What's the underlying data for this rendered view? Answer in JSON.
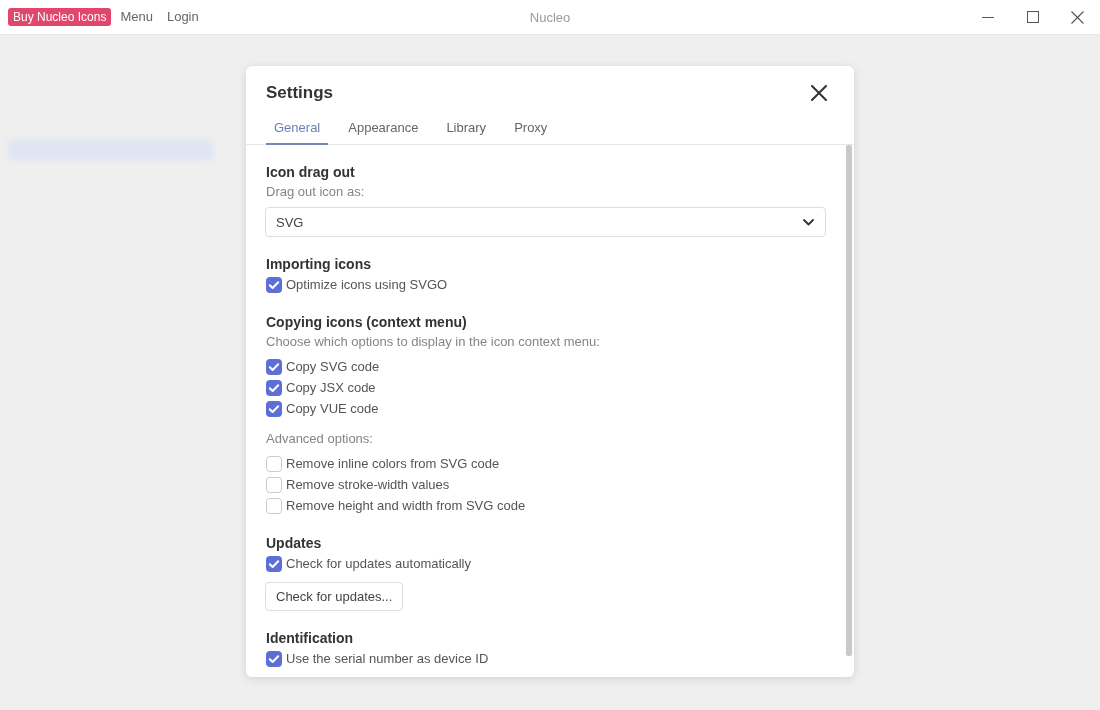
{
  "title_bar": {
    "buy_button": "Buy Nucleo Icons",
    "links": [
      "Menu",
      "Login"
    ],
    "title": "Nucleo"
  },
  "dialog": {
    "title": "Settings",
    "tabs": [
      {
        "label": "General",
        "selected": true
      },
      {
        "label": "Appearance",
        "selected": false
      },
      {
        "label": "Library",
        "selected": false
      },
      {
        "label": "Proxy",
        "selected": false
      }
    ],
    "sections": [
      {
        "heading": "Icon drag out",
        "items": [
          {
            "kind": "text",
            "text": "Drag out icon as:"
          },
          {
            "kind": "select",
            "value": "SVG"
          }
        ]
      },
      {
        "heading": "Importing icons",
        "items": [
          {
            "kind": "checkbox",
            "label": "Optimize icons using SVGO",
            "checked": true
          }
        ]
      },
      {
        "heading": "Copying icons (context menu)",
        "items": [
          {
            "kind": "text",
            "text": "Choose which options to display in the icon context menu:"
          },
          {
            "kind": "checkbox",
            "label": "Copy SVG code",
            "checked": true
          },
          {
            "kind": "checkbox",
            "label": "Copy JSX code",
            "checked": true
          },
          {
            "kind": "checkbox",
            "label": "Copy VUE code",
            "checked": true
          },
          {
            "kind": "text",
            "text": "Advanced options:"
          },
          {
            "kind": "checkbox",
            "label": "Remove inline colors from SVG code",
            "checked": false
          },
          {
            "kind": "checkbox",
            "label": "Remove stroke-width values",
            "checked": false
          },
          {
            "kind": "checkbox",
            "label": "Remove height and width from SVG code",
            "checked": false
          }
        ]
      },
      {
        "heading": "Updates",
        "items": [
          {
            "kind": "checkbox",
            "label": "Check for updates automatically",
            "checked": true
          },
          {
            "kind": "button",
            "label": "Check for updates..."
          }
        ]
      },
      {
        "heading": "Identification",
        "items": [
          {
            "kind": "checkbox",
            "label": "Use the serial number as device ID",
            "checked": true
          }
        ]
      }
    ]
  }
}
